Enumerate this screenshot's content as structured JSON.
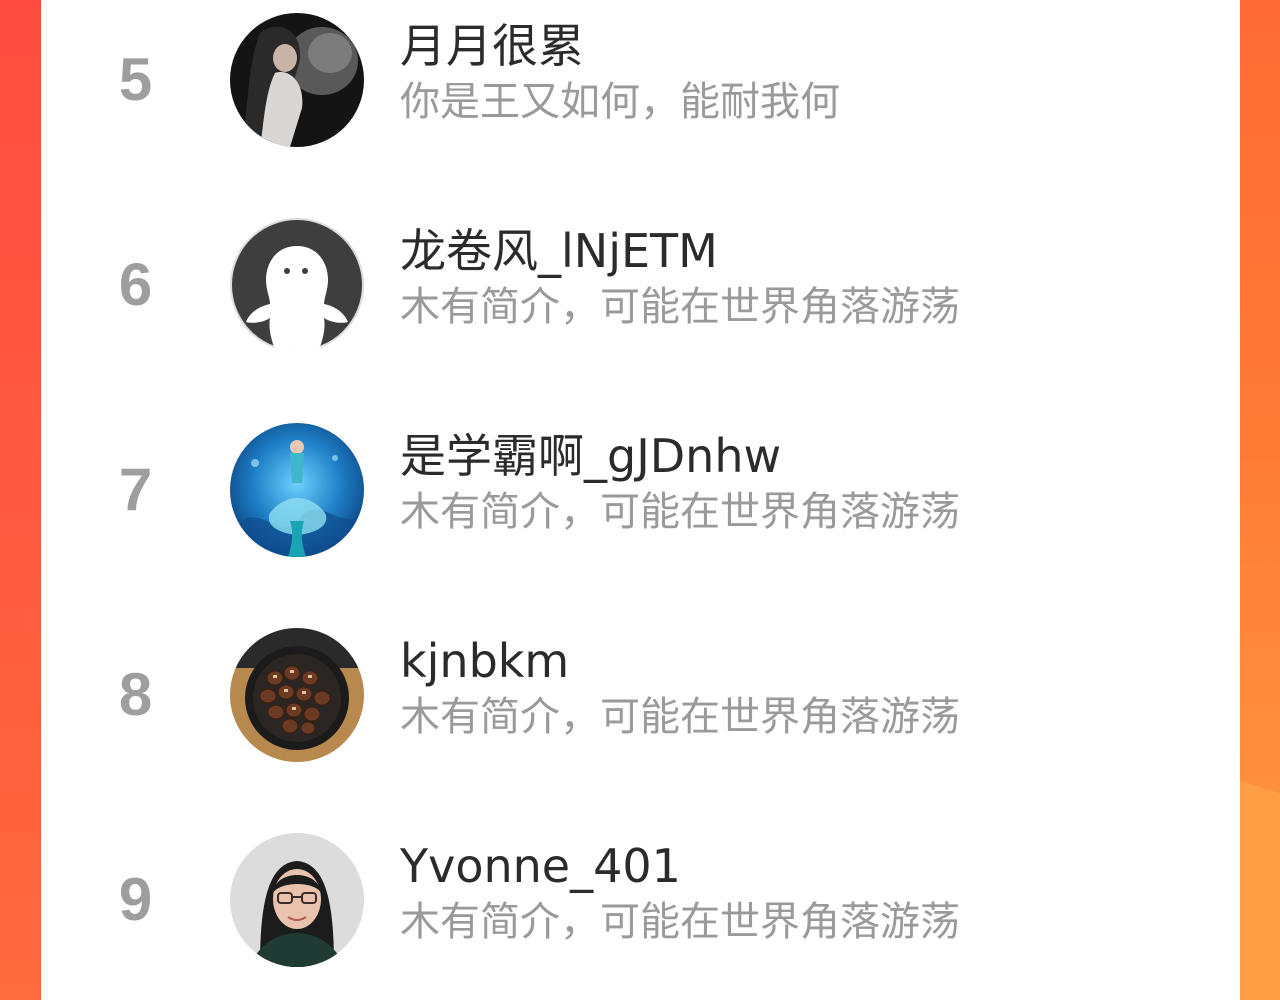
{
  "users": [
    {
      "rank": "5",
      "name": "月月很累",
      "bio": "你是王又如何，能耐我何",
      "avatar_icon": "woman-dark-photo-avatar"
    },
    {
      "rank": "6",
      "name": "龙卷风_lNjETM",
      "bio": "木有简介，可能在世界角落游荡",
      "avatar_icon": "default-ghost-avatar"
    },
    {
      "rank": "7",
      "name": "是学霸啊_gJDnhw",
      "bio": "木有简介，可能在世界角落游荡",
      "avatar_icon": "mermaid-blue-photo-avatar"
    },
    {
      "rank": "8",
      "name": "kjnbkm",
      "bio": "木有简介，可能在世界角落游荡",
      "avatar_icon": "roasted-chestnuts-photo-avatar"
    },
    {
      "rank": "9",
      "name": "Yvonne_401",
      "bio": "木有简介，可能在世界角落游荡",
      "avatar_icon": "woman-glasses-photo-avatar"
    }
  ],
  "colors": {
    "accent_left": "#ff4b40",
    "accent_right": "#ff7c36",
    "rank_gray": "#9e9e9e",
    "name_text": "#2b2b2b",
    "bio_text": "#9a9a9a"
  }
}
